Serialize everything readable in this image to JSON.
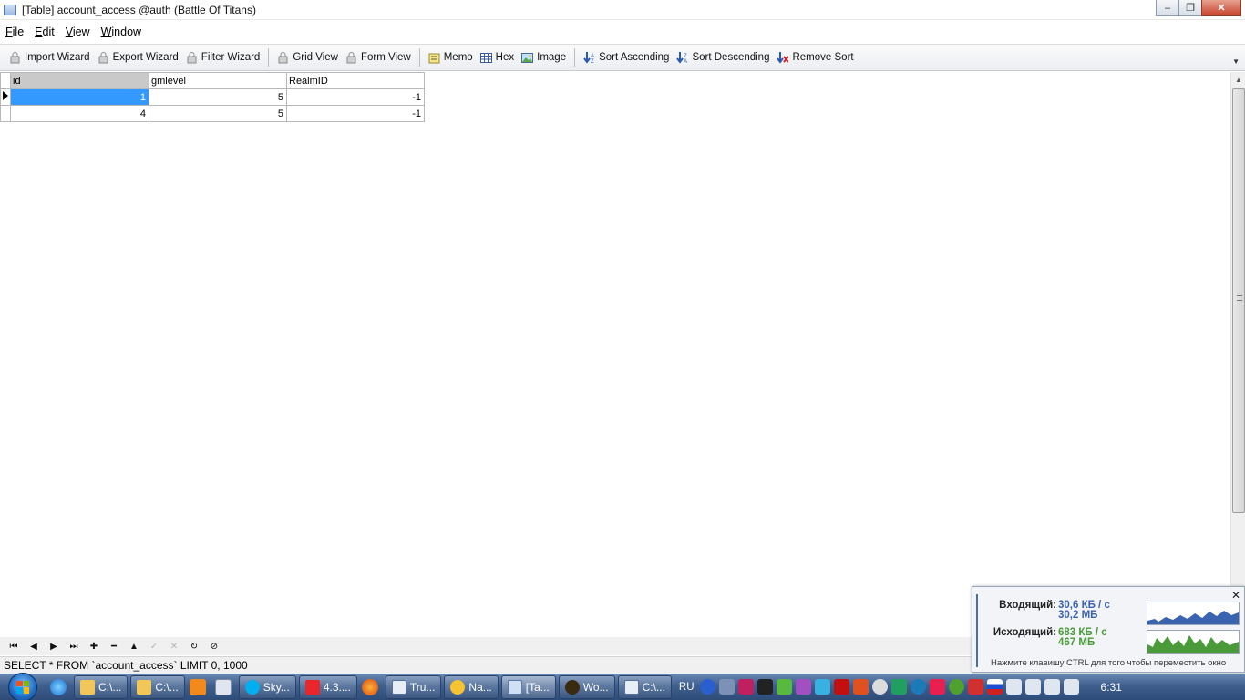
{
  "window": {
    "title": "[Table] account_access @auth (Battle Of Titans)",
    "buttons": {
      "minimize": "‒",
      "maximize": "❐",
      "close": "✕"
    }
  },
  "menu": {
    "items": [
      {
        "label": "File",
        "key": "F",
        "rest": "ile"
      },
      {
        "label": "Edit",
        "key": "E",
        "rest": "dit"
      },
      {
        "label": "View",
        "key": "V",
        "rest": "iew"
      },
      {
        "label": "Window",
        "key": "W",
        "rest": "indow"
      }
    ]
  },
  "toolbar": {
    "import_wizard": "Import Wizard",
    "export_wizard": "Export Wizard",
    "filter_wizard": "Filter Wizard",
    "grid_view": "Grid View",
    "form_view": "Form View",
    "memo": "Memo",
    "hex": "Hex",
    "image": "Image",
    "sort_ascending": "Sort Ascending",
    "sort_descending": "Sort Descending",
    "remove_sort": "Remove Sort"
  },
  "table": {
    "columns": [
      "id",
      "gmlevel",
      "RealmID"
    ],
    "rows": [
      [
        "1",
        "5",
        "-1"
      ],
      [
        "4",
        "5",
        "-1"
      ]
    ]
  },
  "navigator": {
    "first": "⏮",
    "prev": "◀",
    "next": "▶",
    "last": "⏭",
    "insert": "✚",
    "delete": "━",
    "edit": "▲",
    "post": "✓",
    "cancel": "✕",
    "refresh": "↻",
    "stop": "⊘"
  },
  "status": {
    "query": "SELECT * FROM `account_access` LIMIT 0, 1000"
  },
  "netmon": {
    "incoming_label": "Входящий:",
    "incoming_rate": "30,6 КБ / с",
    "incoming_total": "30,2 МБ",
    "outgoing_label": "Исходящий:",
    "outgoing_rate": "683 КБ / с",
    "outgoing_total": "467 МБ",
    "hint": "Нажмите клавишу CTRL для того чтобы переместить окно",
    "close": "✕"
  },
  "taskbar": {
    "tasks": [
      "C:\\...",
      "C:\\...",
      "Sky...",
      "4.3....",
      "Tru...",
      "Na...",
      "[Ta...",
      "Wo...",
      "C:\\..."
    ],
    "lang": "RU",
    "clock": "6:31"
  },
  "colors": {
    "selection": "#3399ff",
    "incoming": "#3a63b0",
    "outgoing": "#4a9a3a"
  }
}
